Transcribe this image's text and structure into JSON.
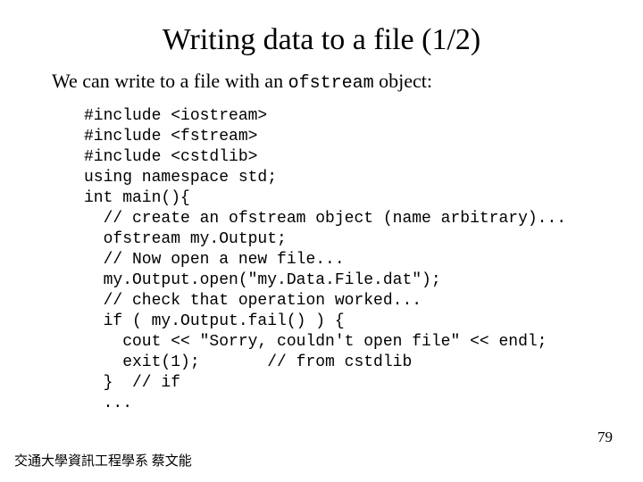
{
  "title": "Writing data to a file (1/2)",
  "intro_before": "We can write to a file with an ",
  "intro_code": "ofstream",
  "intro_after": " object:",
  "code": "#include <iostream>\n#include <fstream>\n#include <cstdlib>\nusing namespace std;\nint main(){\n  // create an ofstream object (name arbitrary)...\n  ofstream my.Output;\n  // Now open a new file...\n  my.Output.open(\"my.Data.File.dat\");\n  // check that operation worked...\n  if ( my.Output.fail() ) {\n    cout << \"Sorry, couldn't open file\" << endl;\n    exit(1);       // from cstdlib\n  }  // if\n  ...",
  "footer": "交通大學資訊工程學系 蔡文能",
  "page_number": "79"
}
